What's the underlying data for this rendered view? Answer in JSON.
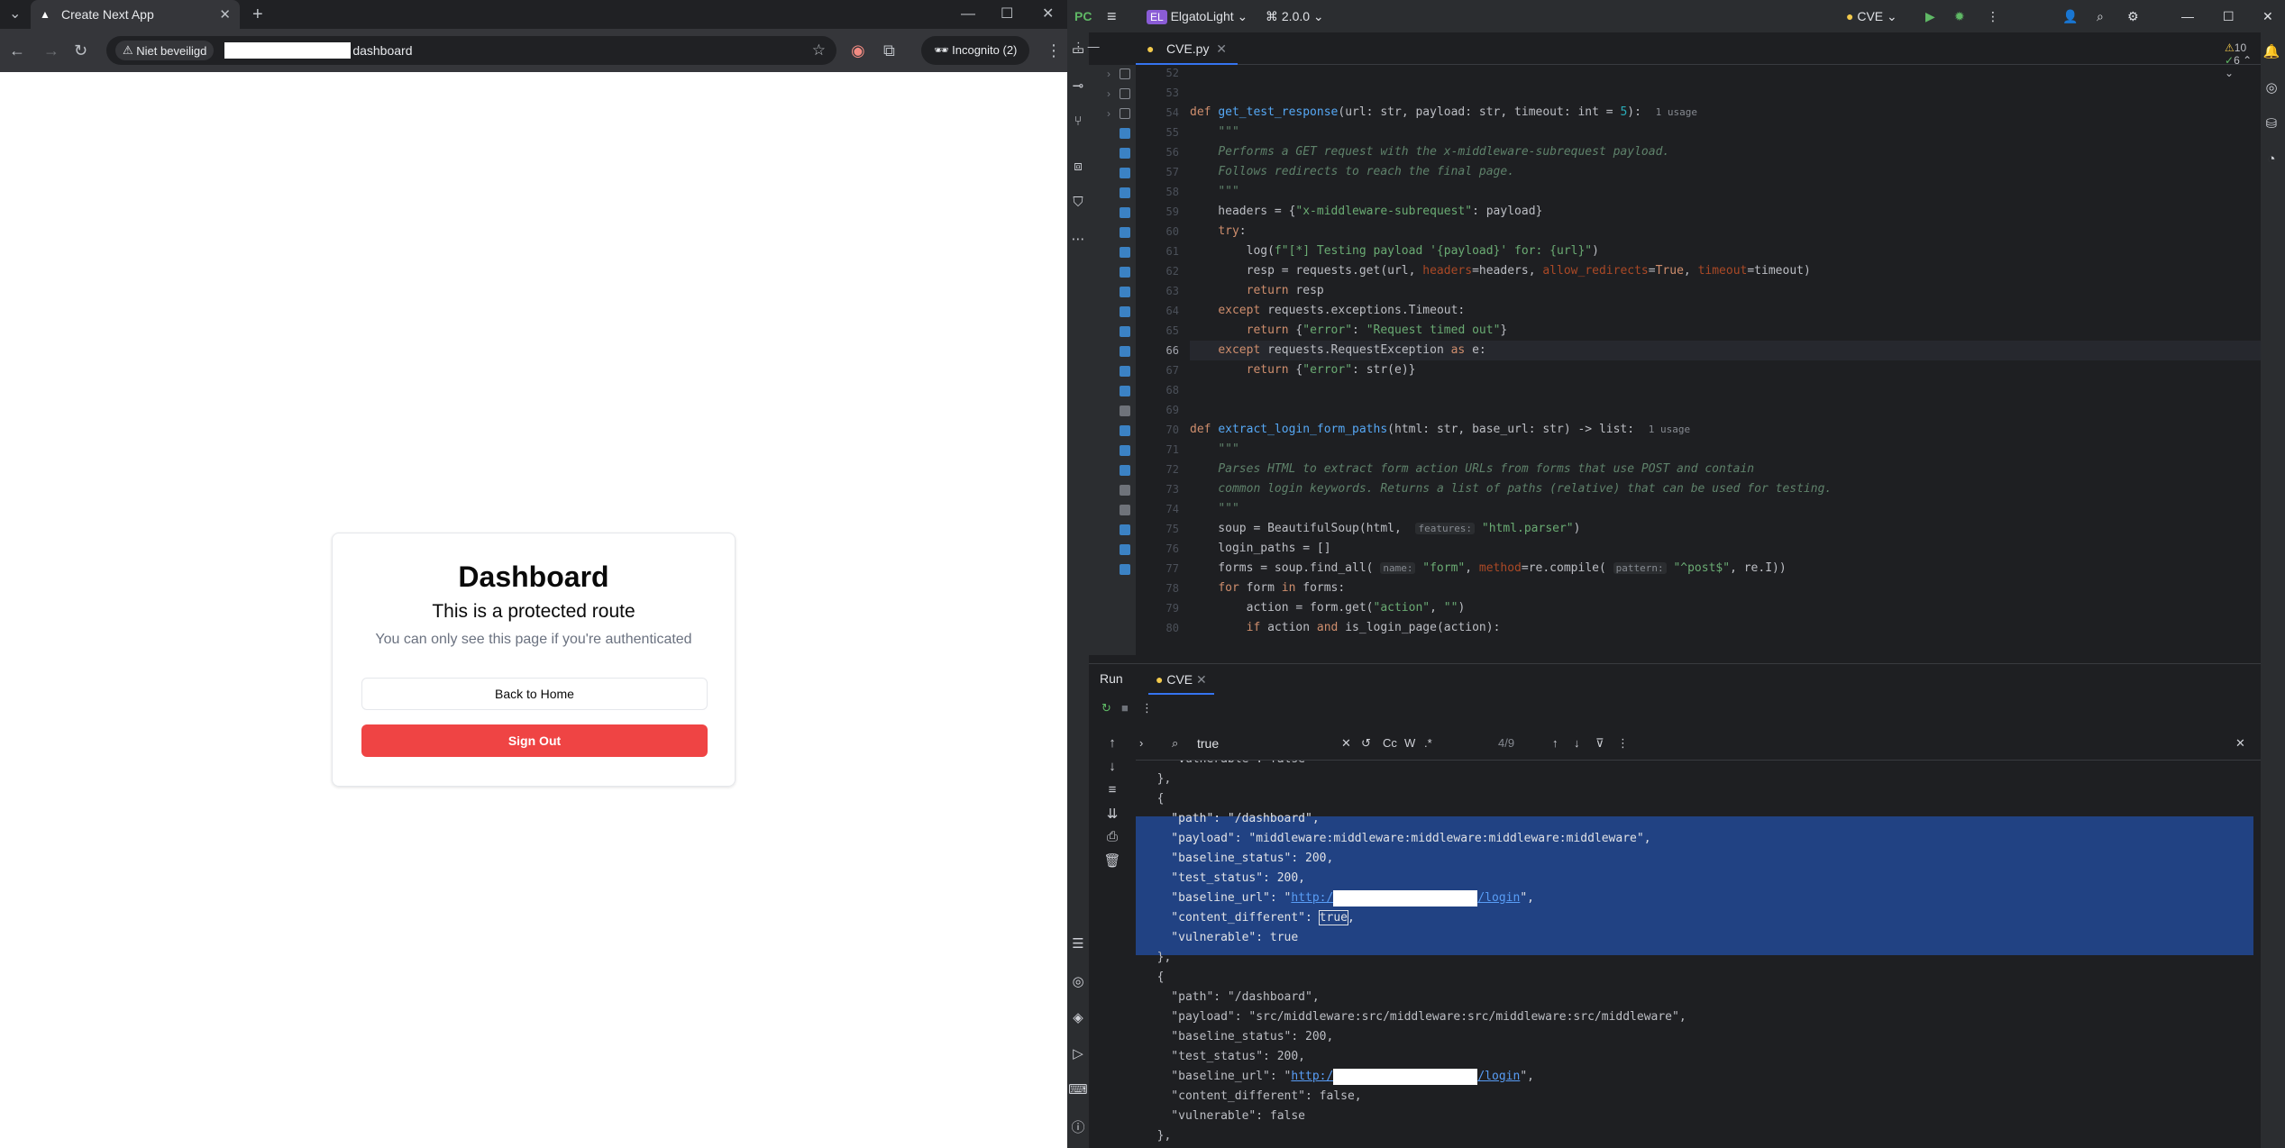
{
  "browser": {
    "tab_title": "Create Next App",
    "security_label": "Niet beveiligd",
    "url_path": "dashboard",
    "incognito_label": "Incognito (2)"
  },
  "page": {
    "title": "Dashboard",
    "subtitle": "This is a protected route",
    "description": "You can only see this page if you're authenticated",
    "back_button": "Back to Home",
    "signout_button": "Sign Out"
  },
  "ide": {
    "project": "ElgatoLight",
    "version": "2.0.0",
    "run_config": "CVE",
    "editor_tab": "CVE.py",
    "warnings": "10",
    "checks": "6",
    "run_label": "Run",
    "run_tab": "CVE",
    "search_query": "true",
    "match_count": "4/9",
    "find_cc": "Cc",
    "find_w": "W",
    "find_re": ".*"
  },
  "colors": {
    "accent": "#3574f0",
    "signout": "#ef4444",
    "selection": "#214283"
  }
}
